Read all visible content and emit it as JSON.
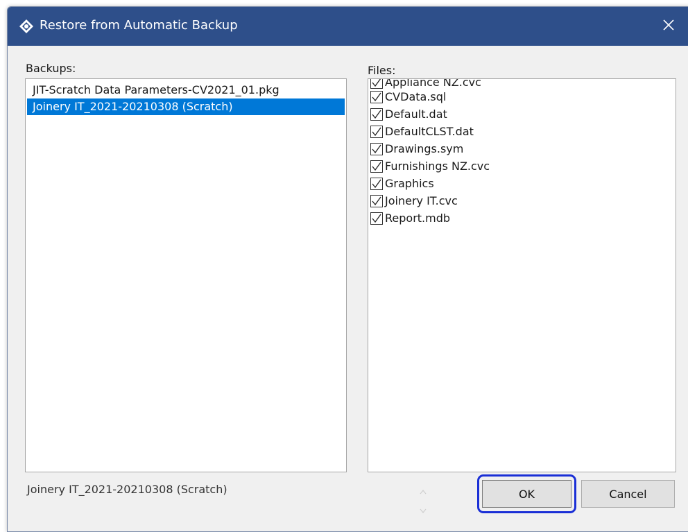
{
  "window": {
    "title": "Restore from Automatic Backup",
    "app_icon": "gear-diamond-icon",
    "close_icon": "close-icon"
  },
  "backups": {
    "label": "Backups:",
    "items": [
      {
        "label": "JIT-Scratch Data Parameters-CV2021_01.pkg",
        "selected": false
      },
      {
        "label": "Joinery IT_2021-20210308 (Scratch)",
        "selected": true
      }
    ]
  },
  "files": {
    "label": "Files:",
    "items": [
      {
        "label": "Appliance NZ.cvc",
        "checked": true
      },
      {
        "label": "CVData.sql",
        "checked": true
      },
      {
        "label": "Default.dat",
        "checked": true
      },
      {
        "label": "DefaultCLST.dat",
        "checked": true
      },
      {
        "label": "Drawings.sym",
        "checked": true
      },
      {
        "label": "Furnishings NZ.cvc",
        "checked": true
      },
      {
        "label": "Graphics",
        "checked": true
      },
      {
        "label": "Joinery IT.cvc",
        "checked": true
      },
      {
        "label": "Report.mdb",
        "checked": true
      }
    ]
  },
  "status": {
    "selected_backup": "Joinery IT_2021-20210308 (Scratch)"
  },
  "buttons": {
    "ok_label": "OK",
    "cancel_label": "Cancel"
  },
  "colors": {
    "titlebar": "#2e4f8a",
    "selection": "#0078d7",
    "highlight_outline": "#1a2fd6"
  }
}
